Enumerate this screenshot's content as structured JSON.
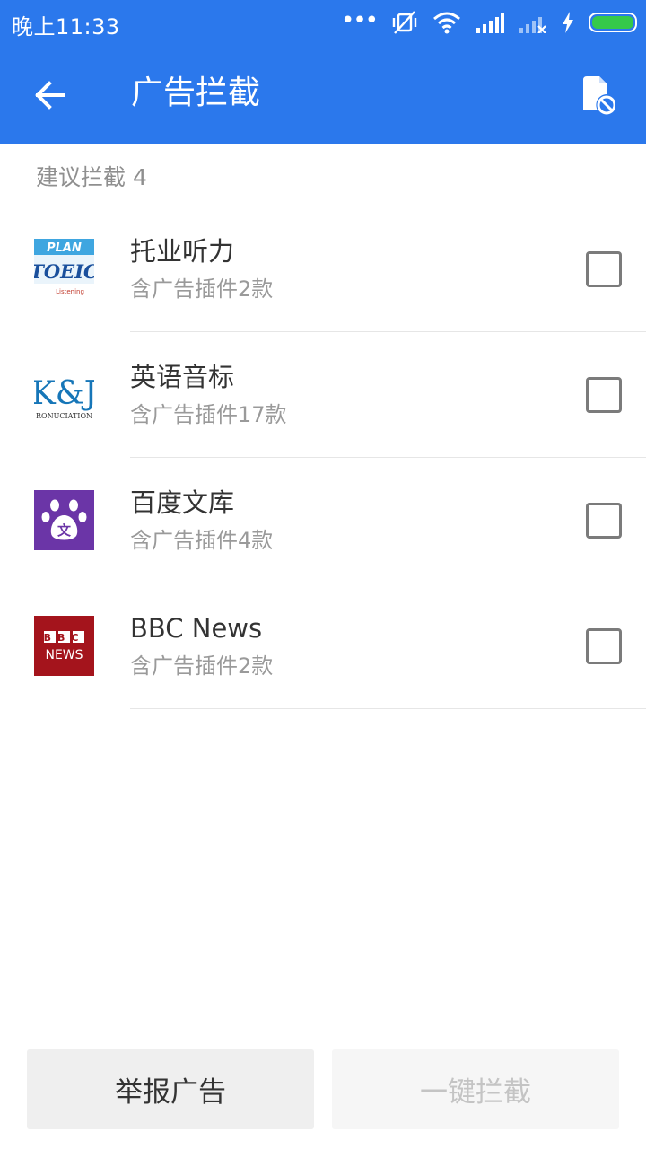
{
  "status_bar": {
    "time": "晚上11:33",
    "battery_color": "#35c94a"
  },
  "app_bar": {
    "title": "广告拦截",
    "background": "#2b78ec",
    "back_icon": "arrow-left-icon",
    "action_icon": "blocked-file-icon"
  },
  "section": {
    "header": "建议拦截 4"
  },
  "apps": [
    {
      "name": "托业听力",
      "desc": "含广告插件2款",
      "icon": "toeic-app-icon",
      "checked": false
    },
    {
      "name": "英语音标",
      "desc": "含广告插件17款",
      "icon": "kj-app-icon",
      "checked": false
    },
    {
      "name": "百度文库",
      "desc": "含广告插件4款",
      "icon": "baidu-wenku-app-icon",
      "checked": false
    },
    {
      "name": "BBC News",
      "desc": "含广告插件2款",
      "icon": "bbc-news-app-icon",
      "checked": false
    }
  ],
  "icon_text": {
    "toeic_top": "PLAN",
    "toeic_main": "TOEIC",
    "toeic_sub": "Listening",
    "kj_main": "K&J",
    "kj_sub": "RONUCIATION",
    "wenku_char": "文",
    "bbc_top": "BBC",
    "bbc_bottom": "NEWS"
  },
  "buttons": {
    "report": "举报广告",
    "block_all": "一键拦截"
  }
}
